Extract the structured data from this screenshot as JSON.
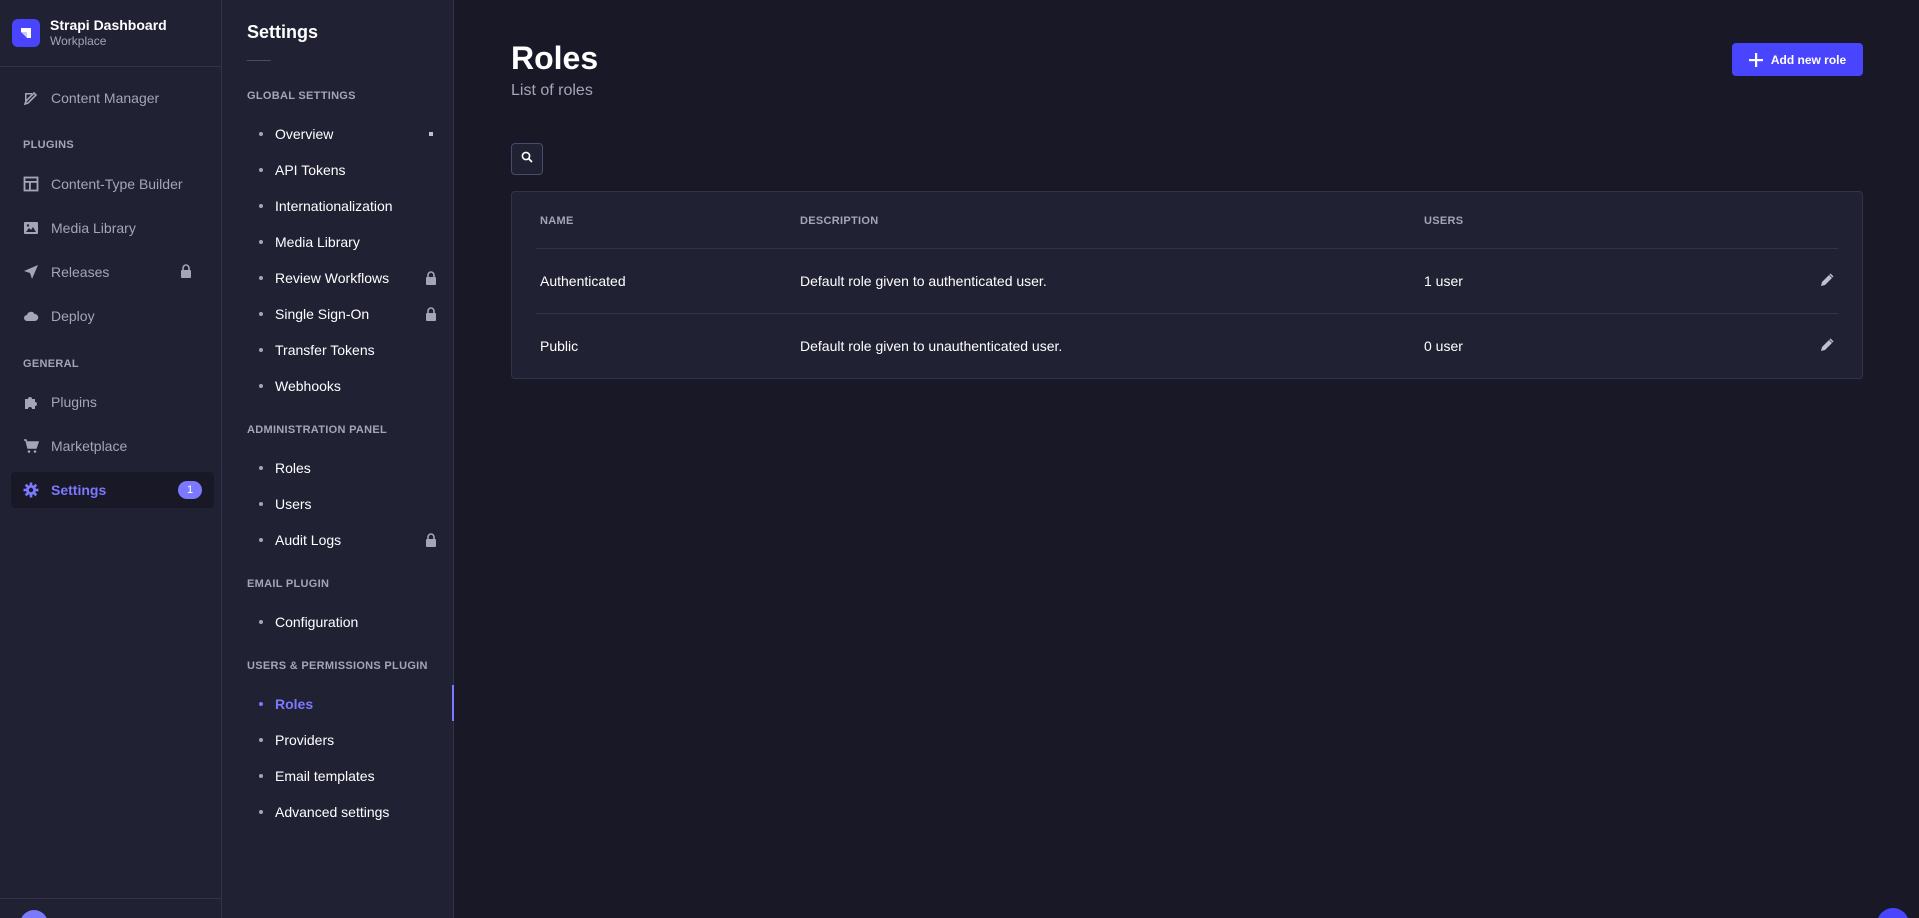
{
  "brand": {
    "title": "Strapi Dashboard",
    "subtitle": "Workplace"
  },
  "mainnav": {
    "content_manager": "Content Manager",
    "plugins_section": "PLUGINS",
    "content_type_builder": "Content-Type Builder",
    "media_library": "Media Library",
    "releases": "Releases",
    "deploy": "Deploy",
    "general_section": "GENERAL",
    "plugins": "Plugins",
    "marketplace": "Marketplace",
    "settings": "Settings",
    "settings_badge": "1"
  },
  "subnav": {
    "title": "Settings",
    "global_section": "GLOBAL SETTINGS",
    "global_items": [
      "Overview",
      "API Tokens",
      "Internationalization",
      "Media Library",
      "Review Workflows",
      "Single Sign-On",
      "Transfer Tokens",
      "Webhooks"
    ],
    "admin_section": "ADMINISTRATION PANEL",
    "admin_items": [
      "Roles",
      "Users",
      "Audit Logs"
    ],
    "email_section": "EMAIL PLUGIN",
    "email_items": [
      "Configuration"
    ],
    "up_section": "USERS & PERMISSIONS PLUGIN",
    "up_items": [
      "Roles",
      "Providers",
      "Email templates",
      "Advanced settings"
    ]
  },
  "page": {
    "title": "Roles",
    "subtitle": "List of roles",
    "add_button": "Add new role"
  },
  "table": {
    "headers": [
      "NAME",
      "DESCRIPTION",
      "USERS"
    ],
    "rows": [
      {
        "name": "Authenticated",
        "description": "Default role given to authenticated user.",
        "users": "1 user"
      },
      {
        "name": "Public",
        "description": "Default role given to unauthenticated user.",
        "users": "0 user"
      }
    ]
  },
  "colors": {
    "accent": "#4945ff",
    "accent_light": "#7b79ff",
    "bg": "#181826",
    "panel": "#212134",
    "muted": "#a5a5ba"
  },
  "icons": [
    "strapi-logo-icon",
    "feather-icon",
    "layout-icon",
    "image-icon",
    "paper-plane-icon",
    "cloud-icon",
    "puzzle-icon",
    "cart-icon",
    "gear-icon",
    "lock-icon",
    "plus-icon",
    "search-icon",
    "pencil-icon"
  ]
}
